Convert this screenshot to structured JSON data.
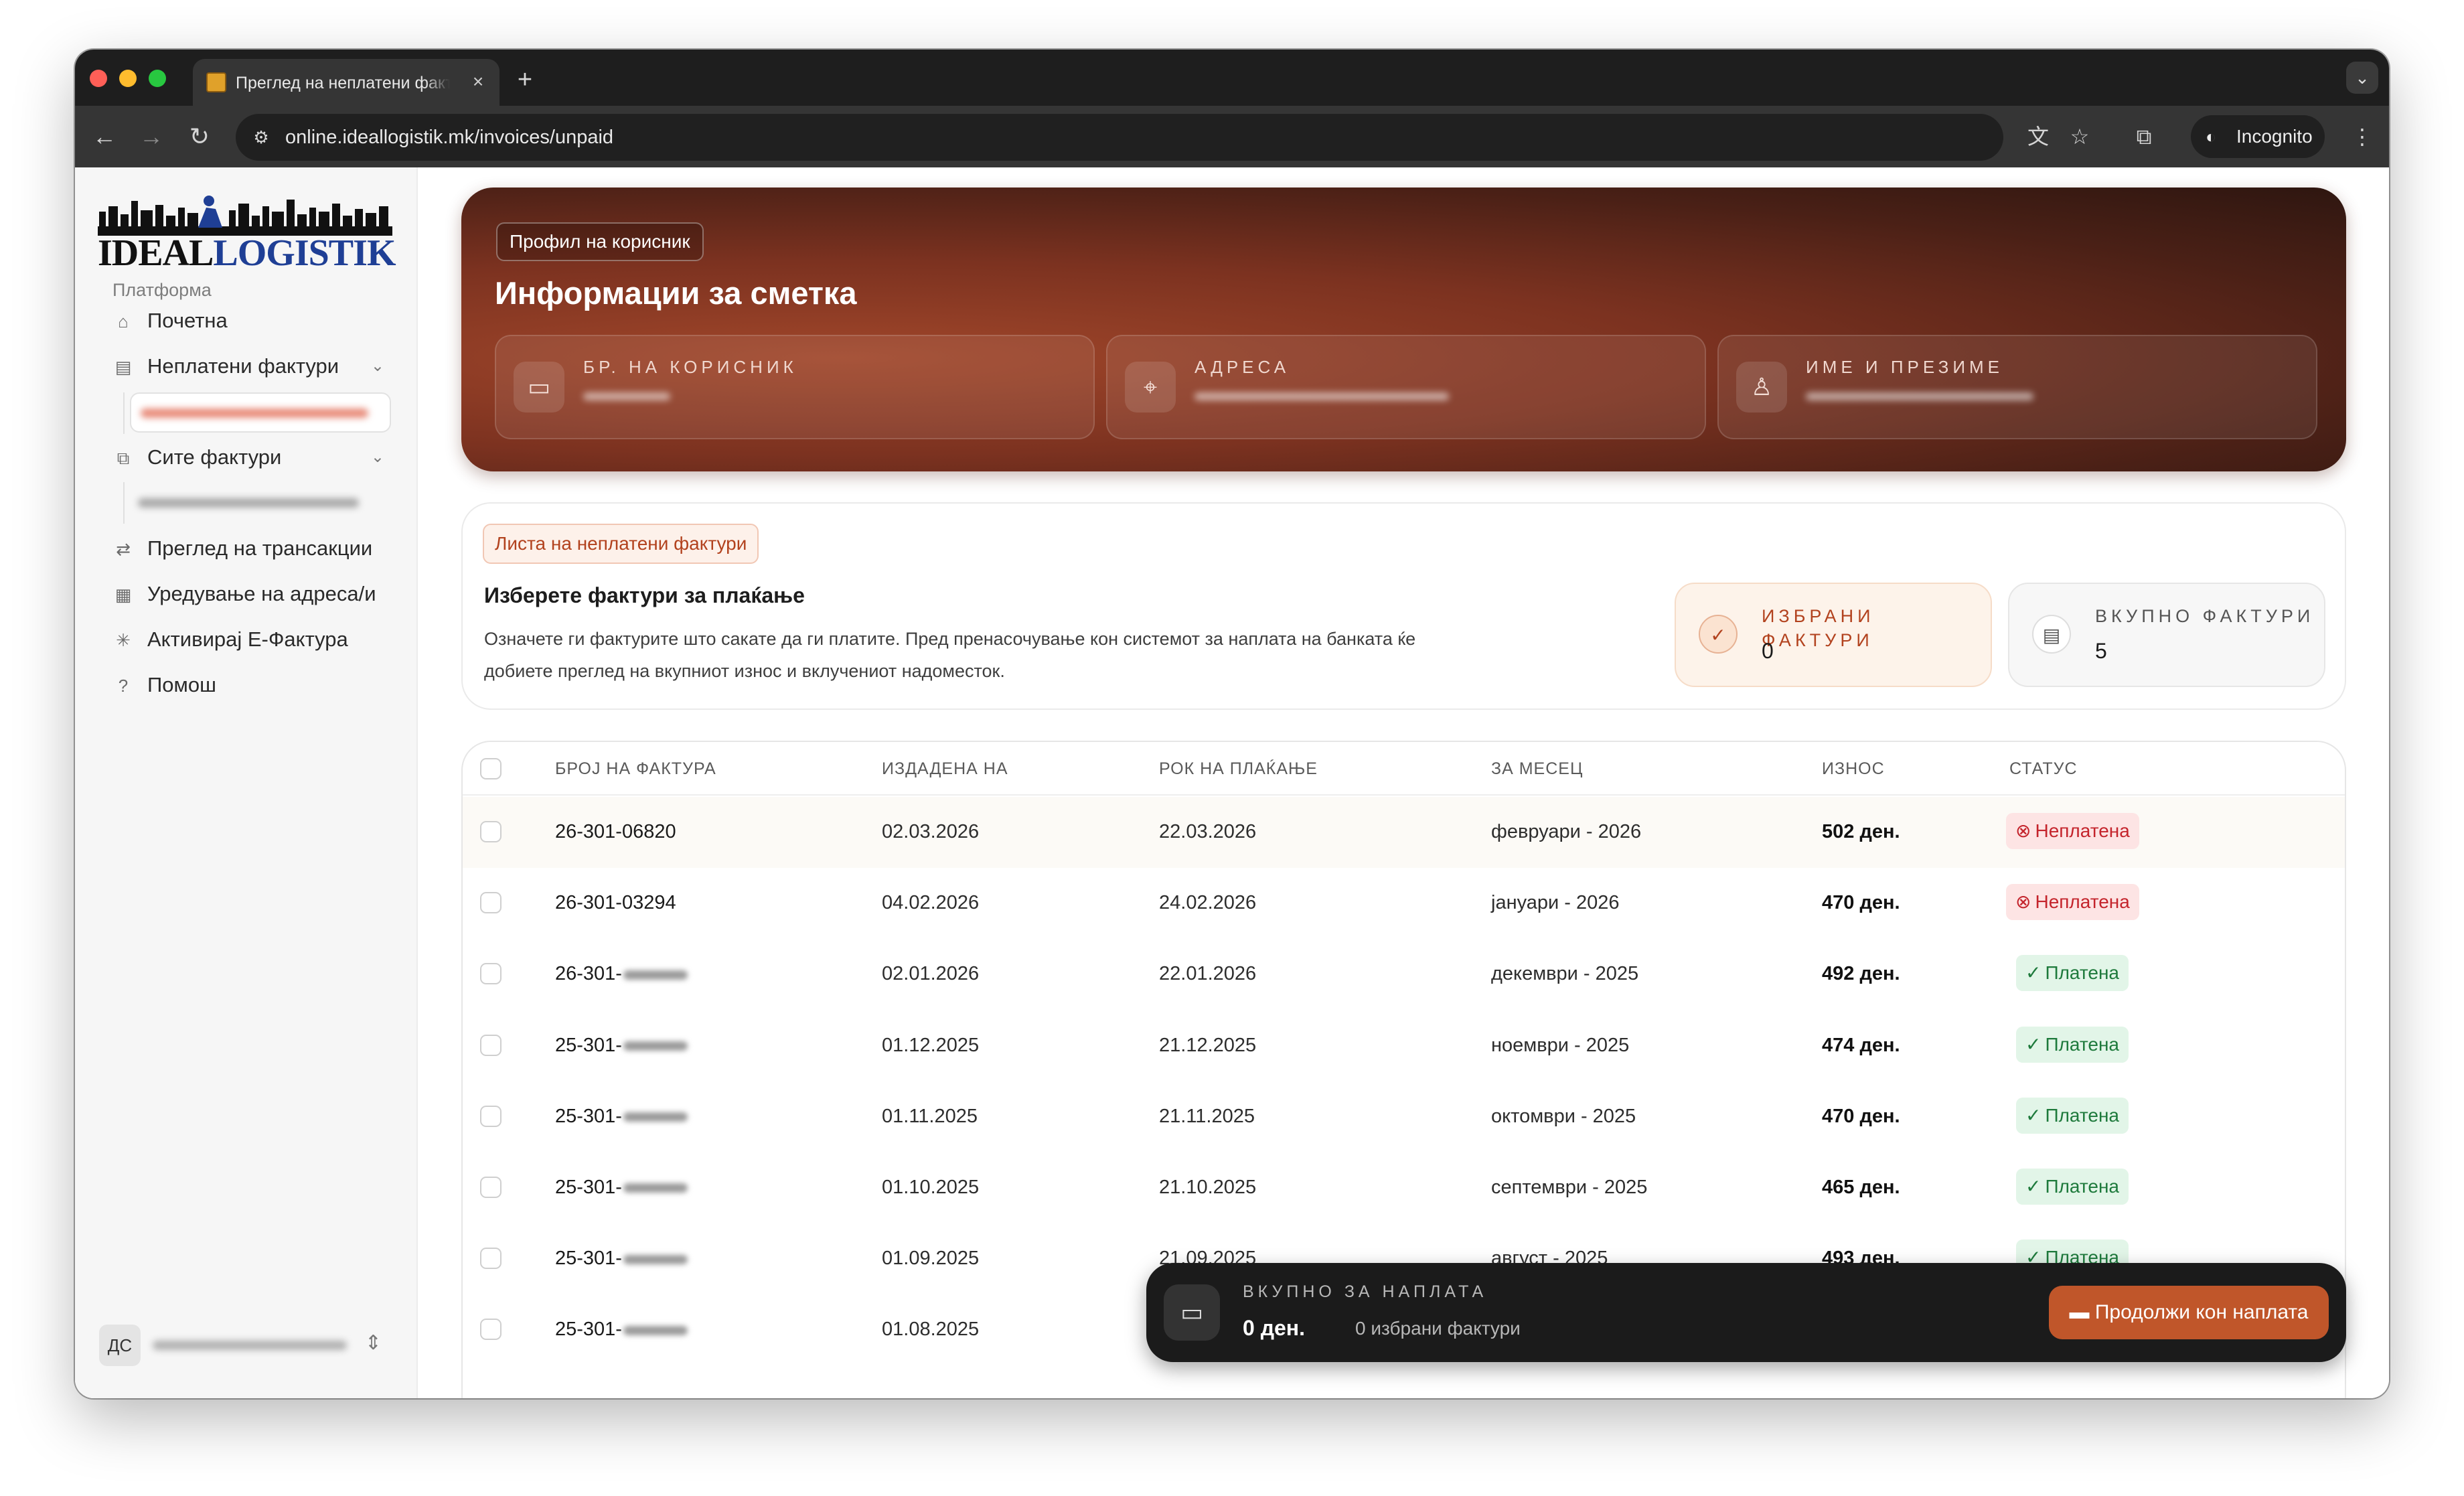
{
  "browser": {
    "tab_title": "Преглед на неплатени факт…",
    "new_tab": "+",
    "tab_close": "×",
    "tab_menu": "⌄",
    "url": "online.ideallogistik.mk/invoices/unpaid",
    "incognito_label": "Incognito",
    "traffic_lights": [
      "#ff5f57",
      "#febc2e",
      "#28c840"
    ]
  },
  "sidebar": {
    "logo": {
      "part1": "IDEAL",
      "part2": "LOGISTIK"
    },
    "section_label": "Платформа",
    "items": [
      {
        "label": "Почетна",
        "icon": "home-icon",
        "chevron": false
      },
      {
        "label": "Неплатени фактури",
        "icon": "invoice-icon",
        "chevron": true
      },
      {
        "label": "Сите фактури",
        "icon": "files-icon",
        "chevron": true
      },
      {
        "label": "Преглед на трансакции",
        "icon": "transfer-icon",
        "chevron": false
      },
      {
        "label": "Уредување на адреса/и",
        "icon": "building-icon",
        "chevron": false
      },
      {
        "label": "Активирај Е-Фактура",
        "icon": "sparkle-icon",
        "chevron": false
      },
      {
        "label": "Помош",
        "icon": "help-icon",
        "chevron": false
      }
    ],
    "user_initials": "ДС"
  },
  "hero": {
    "badge": "Профил на корисник",
    "title": "Информации за сметка",
    "cards": [
      {
        "label": "БР. НА КОРИСНИК",
        "icon": "id-card-icon"
      },
      {
        "label": "АДРЕСА",
        "icon": "location-pin-icon"
      },
      {
        "label": "ИМЕ И ПРЕЗИМЕ",
        "icon": "user-icon"
      }
    ]
  },
  "select_panel": {
    "badge": "Листа на неплатени фактури",
    "title": "Изберете фактури за плаќање",
    "description": "Означете ги фактурите што сакате да ги платите. Пред пренасочување кон системот за наплата на банката ќе добиете преглед на вкупниот износ и вклучениот надоместок.",
    "stats": {
      "selected_label": "ИЗБРАНИ ФАКТУРИ",
      "selected_value": "0",
      "total_label": "ВКУПНО ФАКТУРИ",
      "total_value": "5"
    }
  },
  "table": {
    "columns": [
      "БРОЈ НА ФАКТУРА",
      "ИЗДАДЕНА НА",
      "РОК НА ПЛАЌАЊЕ",
      "ЗА МЕСЕЦ",
      "ИЗНОС",
      "СТАТУС"
    ],
    "rows": [
      {
        "number": "26-301-06820",
        "issued": "02.03.2026",
        "due": "22.03.2026",
        "month": "февруари - 2026",
        "amount": "502 ден.",
        "status": "Неплатена",
        "paid": false,
        "redacted": false
      },
      {
        "number": "26-301-03294",
        "issued": "04.02.2026",
        "due": "24.02.2026",
        "month": "јануари - 2026",
        "amount": "470 ден.",
        "status": "Неплатена",
        "paid": false,
        "redacted": false
      },
      {
        "number": "26-301-",
        "issued": "02.01.2026",
        "due": "22.01.2026",
        "month": "декември - 2025",
        "amount": "492 ден.",
        "status": "Платена",
        "paid": true,
        "redacted": true
      },
      {
        "number": "25-301-",
        "issued": "01.12.2025",
        "due": "21.12.2025",
        "month": "ноември - 2025",
        "amount": "474 ден.",
        "status": "Платена",
        "paid": true,
        "redacted": true
      },
      {
        "number": "25-301-",
        "issued": "01.11.2025",
        "due": "21.11.2025",
        "month": "октомври - 2025",
        "amount": "470 ден.",
        "status": "Платена",
        "paid": true,
        "redacted": true
      },
      {
        "number": "25-301-",
        "issued": "01.10.2025",
        "due": "21.10.2025",
        "month": "септември - 2025",
        "amount": "465 ден.",
        "status": "Платена",
        "paid": true,
        "redacted": true
      },
      {
        "number": "25-301-",
        "issued": "01.09.2025",
        "due": "21.09.2025",
        "month": "август - 2025",
        "amount": "493 ден.",
        "status": "Платена",
        "paid": true,
        "redacted": true
      },
      {
        "number": "25-301-",
        "issued": "01.08.2025",
        "due": "",
        "month": "",
        "amount": "",
        "status": "",
        "paid": true,
        "redacted": true
      }
    ]
  },
  "pay_bar": {
    "label": "ВКУПНО ЗА НАПЛАТА",
    "amount": "0 ден.",
    "count": "0 избрани фактури",
    "button": "Продолжи кон наплата"
  },
  "colors": {
    "accent": "#c0562a",
    "hero_start": "#a0462a",
    "hero_end": "#2e1610",
    "unpaid_text": "#c4242c",
    "paid_text": "#1e7a3c"
  }
}
